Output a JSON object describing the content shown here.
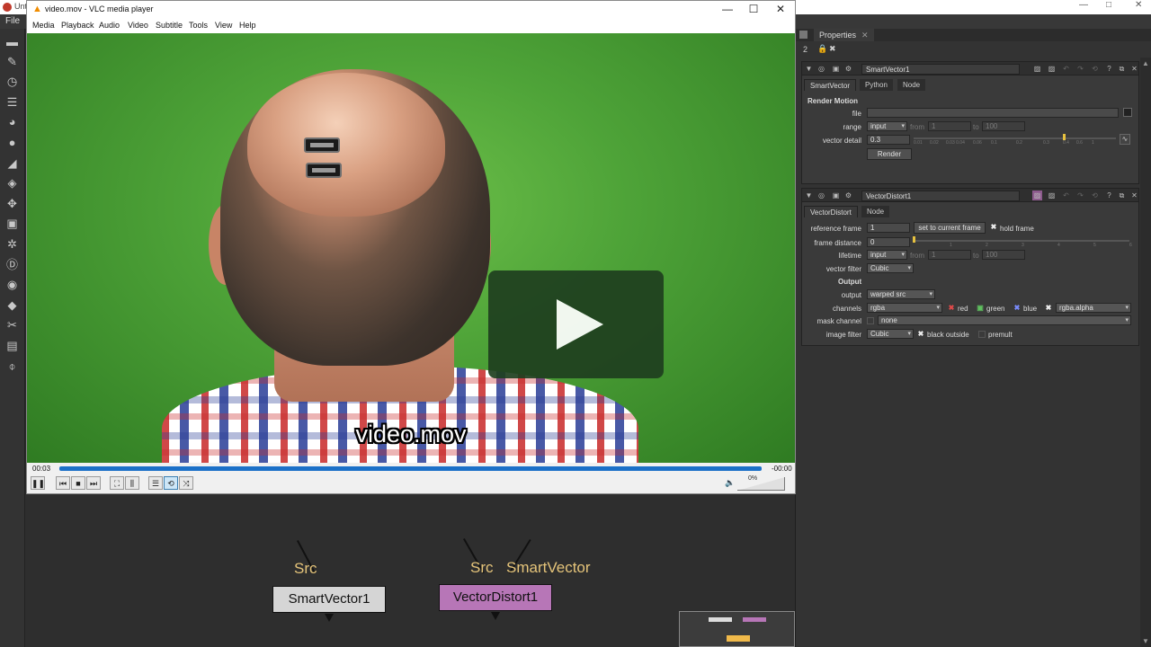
{
  "nuke": {
    "title": "Unt",
    "menu_file": "File",
    "window_controls": [
      "—",
      "□",
      "✕"
    ],
    "toolbar_icons": [
      "viewer-icon",
      "paint-icon",
      "time-icon",
      "channel-icon",
      "color-icon",
      "filter-icon",
      "keyer-icon",
      "merge-icon",
      "transform-icon",
      "3d-icon",
      "particles-icon",
      "deep-icon",
      "views-icon",
      "metadata-icon",
      "toolsets-icon",
      "other-icon",
      "plugin-icon"
    ],
    "toolbar_glyphs": [
      "▬",
      "✎",
      "◷",
      "☰",
      "◕",
      "●",
      "◢",
      "◈",
      "✥",
      "▣",
      "✲",
      "Ⓓ",
      "◉",
      "◆",
      "✂",
      "▤",
      "⌽"
    ]
  },
  "vlc": {
    "title": "video.mov - VLC media player",
    "menu": [
      "Media",
      "Playback",
      "Audio",
      "Video",
      "Subtitle",
      "Tools",
      "View",
      "Help"
    ],
    "window_controls": [
      "—",
      "☐",
      "✕"
    ],
    "subtitle": "video.mov",
    "time_elapsed": "00:03",
    "time_remaining": "-00:00",
    "progress_fraction": 1.0,
    "volume": "0%",
    "controls": {
      "pause": "❚❚",
      "prev": "⏮",
      "stop": "■",
      "next": "⏭",
      "fullscreen": "⛶",
      "extended": "⫼",
      "playlist": "☰",
      "loop": "⟲",
      "random": "⤨",
      "mute": "🔈"
    }
  },
  "properties": {
    "tab": "Properties",
    "tab_close": "✕",
    "subbar_number": "2",
    "smartvector": {
      "name": "SmartVector1",
      "tabs": [
        "SmartVector",
        "Python",
        "Node"
      ],
      "section": "Render Motion",
      "file_label": "file",
      "file_value": "",
      "range_label": "range",
      "range_value": "input",
      "from_label": "from",
      "from_value": "1",
      "to_label": "to",
      "to_value": "100",
      "vector_detail_label": "vector detail",
      "vector_detail_value": "0.3",
      "ticks": [
        "0.01",
        "0.02",
        "0.03 0.04",
        "0.06",
        "0.1",
        "0.2",
        "0.3",
        "0.4",
        "0.6",
        "1"
      ],
      "render_button": "Render"
    },
    "vectordistort": {
      "name": "VectorDistort1",
      "tabs": [
        "VectorDistort",
        "Node"
      ],
      "reference_frame_label": "reference frame",
      "reference_frame_value": "1",
      "set_current_button": "set to current frame",
      "hold_frame_label": "hold frame",
      "frame_distance_label": "frame distance",
      "frame_distance_value": "0",
      "distance_ticks": [
        "1",
        "2",
        "3",
        "4",
        "5",
        "6"
      ],
      "lifetime_label": "lifetime",
      "lifetime_value": "input",
      "from_label": "from",
      "from_value": "1",
      "to_label": "to",
      "to_value": "100",
      "vector_filter_label": "vector filter",
      "vector_filter_value": "Cubic",
      "output_section": "Output",
      "output_label": "output",
      "output_value": "warped src",
      "channels_label": "channels",
      "channels_value": "rgba",
      "red_label": "red",
      "green_label": "green",
      "blue_label": "blue",
      "alpha_value": "rgba.alpha",
      "mask_channel_label": "mask channel",
      "mask_value": "none",
      "image_filter_label": "image filter",
      "image_filter_value": "Cubic",
      "black_outside_label": "black outside",
      "premult_label": "premult"
    }
  },
  "node_graph": {
    "node1_label": "SmartVector1",
    "node1_input": "Src",
    "node2_label": "VectorDistort1",
    "node2_input_src": "Src",
    "node2_input_sv": "SmartVector"
  },
  "colors": {
    "smartvector_node": "#d5d5d5",
    "vectordistort_node": "#b776b7",
    "pipe_label": "#e5c47a",
    "vlc_seek": "#1b70c8",
    "green_screen": "#4ea338"
  }
}
